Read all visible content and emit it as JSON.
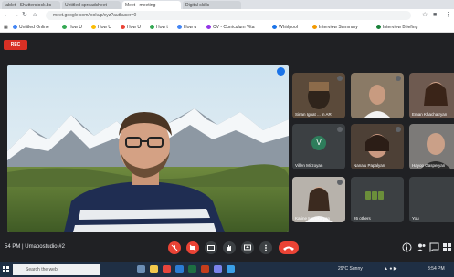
{
  "browser": {
    "tabs": [
      {
        "label": "tablet - Shutterstock.bc"
      },
      {
        "label": "Untitled spreadsheet"
      },
      {
        "label": "Meet - meeting"
      },
      {
        "label": "Digital skills"
      }
    ],
    "url": "meet.google.com/lookup/xyz?authuser=0",
    "bookmarks": [
      {
        "label": "Untitled Online",
        "color": "#4285f4"
      },
      {
        "label": "How U",
        "color": "#34a853"
      },
      {
        "label": "How U",
        "color": "#fbbc04"
      },
      {
        "label": "How U",
        "color": "#ea4335"
      },
      {
        "label": "How t",
        "color": "#34a853"
      },
      {
        "label": "How u",
        "color": "#4285f4"
      },
      {
        "label": "CV - Curriculum Vita",
        "color": "#9334e6"
      },
      {
        "label": "Whirlpool",
        "color": "#1a73e8"
      },
      {
        "label": "Interview Summary",
        "color": "#f29900"
      },
      {
        "label": "Interview Briefing",
        "color": "#188038"
      }
    ]
  },
  "meet": {
    "rec_label": "REC",
    "main_speaker": {
      "pin_icon": "pin-icon"
    },
    "participants": [
      {
        "name": "Sinan Ignat ... in AR"
      },
      {
        "name": ""
      },
      {
        "name": "Eman Khachatryan"
      },
      {
        "name": "Villen Mirzoyan",
        "initial": "V"
      },
      {
        "name": "Nanalu Papalyan"
      },
      {
        "name": "Hayop Gasperyan"
      },
      {
        "name": "Karine Marekaryan"
      },
      {
        "name": "26 others"
      },
      {
        "name": "You"
      }
    ],
    "meeting_time": "54 PM",
    "meeting_name": "Umapostudio #2"
  },
  "taskbar": {
    "search_placeholder": "Search the web",
    "weather": "29°C Sunny",
    "clock": "3:54 PM"
  },
  "colors": {
    "accent": "#1a73e8",
    "danger": "#ea4335",
    "meet_bg": "#202124"
  }
}
